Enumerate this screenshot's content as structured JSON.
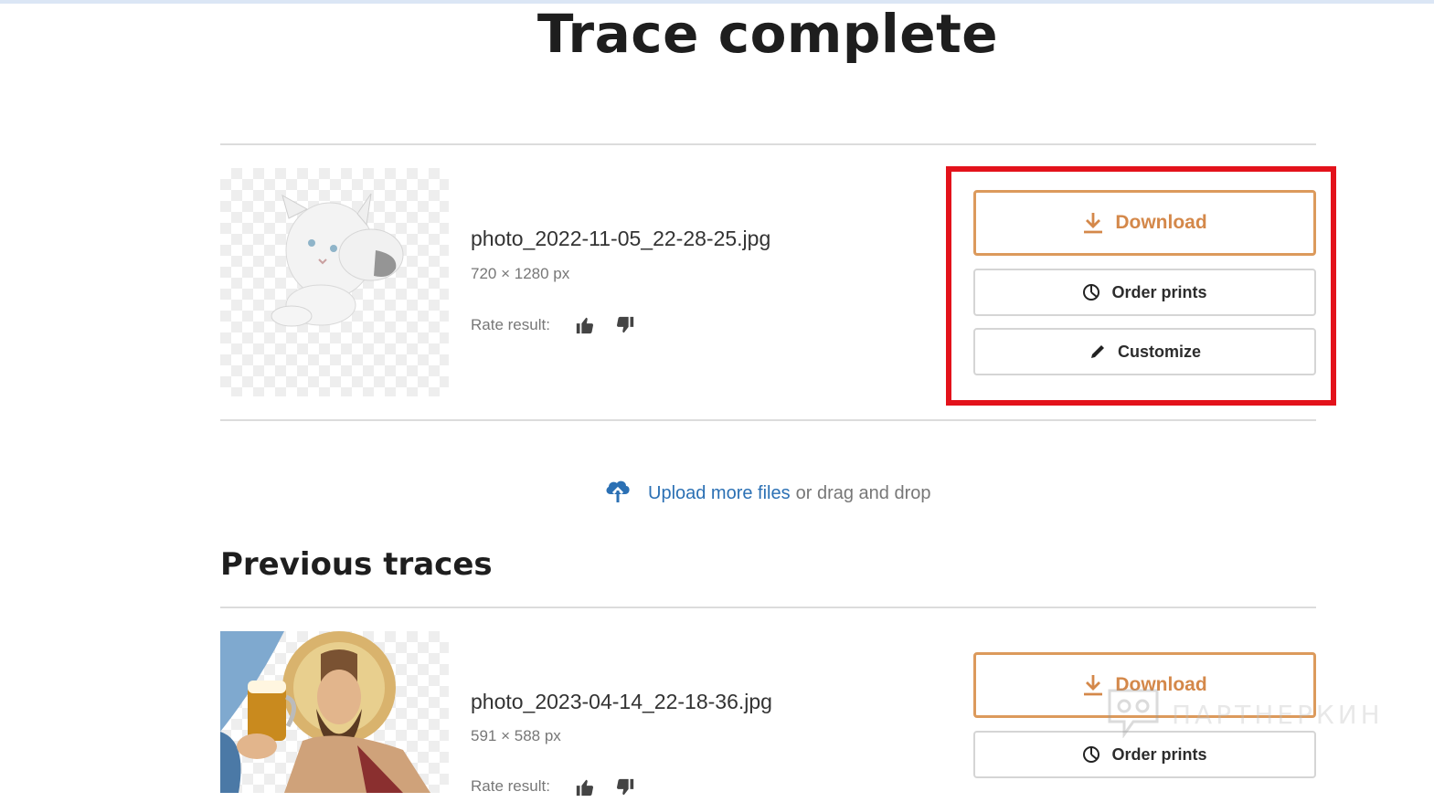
{
  "page": {
    "title": "Trace complete"
  },
  "current": {
    "file_name": "photo_2022-11-05_22-28-25.jpg",
    "dimensions": "720 × 1280 px",
    "rate_label": "Rate result:",
    "thumbnail": "white-cat-cutout",
    "actions": {
      "download": "Download",
      "order_prints": "Order prints",
      "customize": "Customize"
    }
  },
  "upload": {
    "link_text": "Upload more files",
    "rest_text": "or drag and drop"
  },
  "previous": {
    "title": "Previous traces",
    "items": [
      {
        "file_name": "photo_2023-04-14_22-18-36.jpg",
        "dimensions": "591 × 588 px",
        "rate_label": "Rate result:",
        "thumbnail": "bearded-man-with-beer-illustration",
        "actions": {
          "download": "Download",
          "order_prints": "Order prints"
        }
      }
    ]
  },
  "watermark": {
    "text": "ПАРТНЕРКИН"
  },
  "colors": {
    "accent": "#d4884a",
    "accent_border": "#dc9a5c",
    "link": "#2b70b4",
    "highlight": "#e3121b"
  }
}
